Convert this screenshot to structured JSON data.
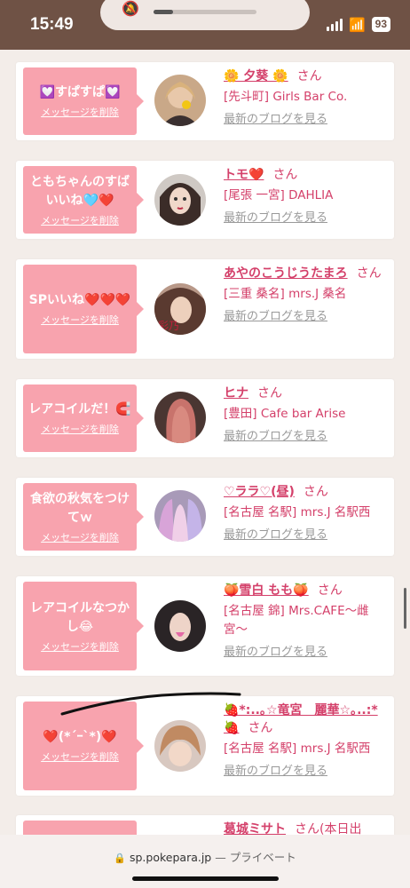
{
  "status_bar": {
    "time": "15:49",
    "battery": "93"
  },
  "cards": [
    {
      "message": "💟すぱすぱ💟",
      "delete_label": "メッセージを削除",
      "name": "🌼 夕葵 🌼",
      "san": "さん",
      "shop": "[先斗町] Girls Bar Co.",
      "blog": "最新のブログを見る"
    },
    {
      "message": "ともちゃんのすばいいね🩵❤️",
      "delete_label": "メッセージを削除",
      "name": "トモ❤️",
      "san": "さん",
      "shop": "[尾張 一宮] DAHLIA",
      "blog": "最新のブログを見る"
    },
    {
      "message": "SPいいね❤️❤️❤️",
      "delete_label": "メッセージを削除",
      "name": "あやのこうじうたまろ",
      "san": "さん",
      "shop": "[三重 桑名] mrs.J 桑名",
      "blog": "最新のブログを見る"
    },
    {
      "message": "レアコイルだ！🧲",
      "delete_label": "メッセージを削除",
      "name": "ヒナ",
      "san": "さん",
      "shop": "[豊田] Cafe bar Arise",
      "blog": "最新のブログを見る"
    },
    {
      "message": "食欲の秋気をつけてｗ",
      "delete_label": "メッセージを削除",
      "name": "♡ララ♡(昼)",
      "san": "さん",
      "shop": "[名古屋 名駅] mrs.J 名駅西",
      "blog": "最新のブログを見る"
    },
    {
      "message": "レアコイルなつかし😂",
      "delete_label": "メッセージを削除",
      "name": "🍑雪白 もも🍑",
      "san": "さん",
      "shop": "[名古屋 錦] Mrs.CAFE〜雌宮〜",
      "blog": "最新のブログを見る"
    },
    {
      "message": "❤️(*´ｰ`*)❤️",
      "delete_label": "メッセージを削除",
      "name": "🍓*:..｡☆竜宮　麗華☆｡..:*🍓",
      "san": "さん",
      "shop": "[名古屋 名駅] mrs.J 名駅西",
      "blog": "最新のブログを見る"
    },
    {
      "message": "",
      "delete_label": "",
      "name": "葛城ミサト",
      "san": "さん(本日出",
      "shop": "",
      "blog": ""
    }
  ],
  "url_bar": {
    "domain": "sp.pokepara.jp",
    "separator": " — ",
    "mode": "プライベート"
  },
  "colors": {
    "accent_pink": "#f8a3ae",
    "name_pink": "#d4406a",
    "status_bar": "#6f5245"
  }
}
